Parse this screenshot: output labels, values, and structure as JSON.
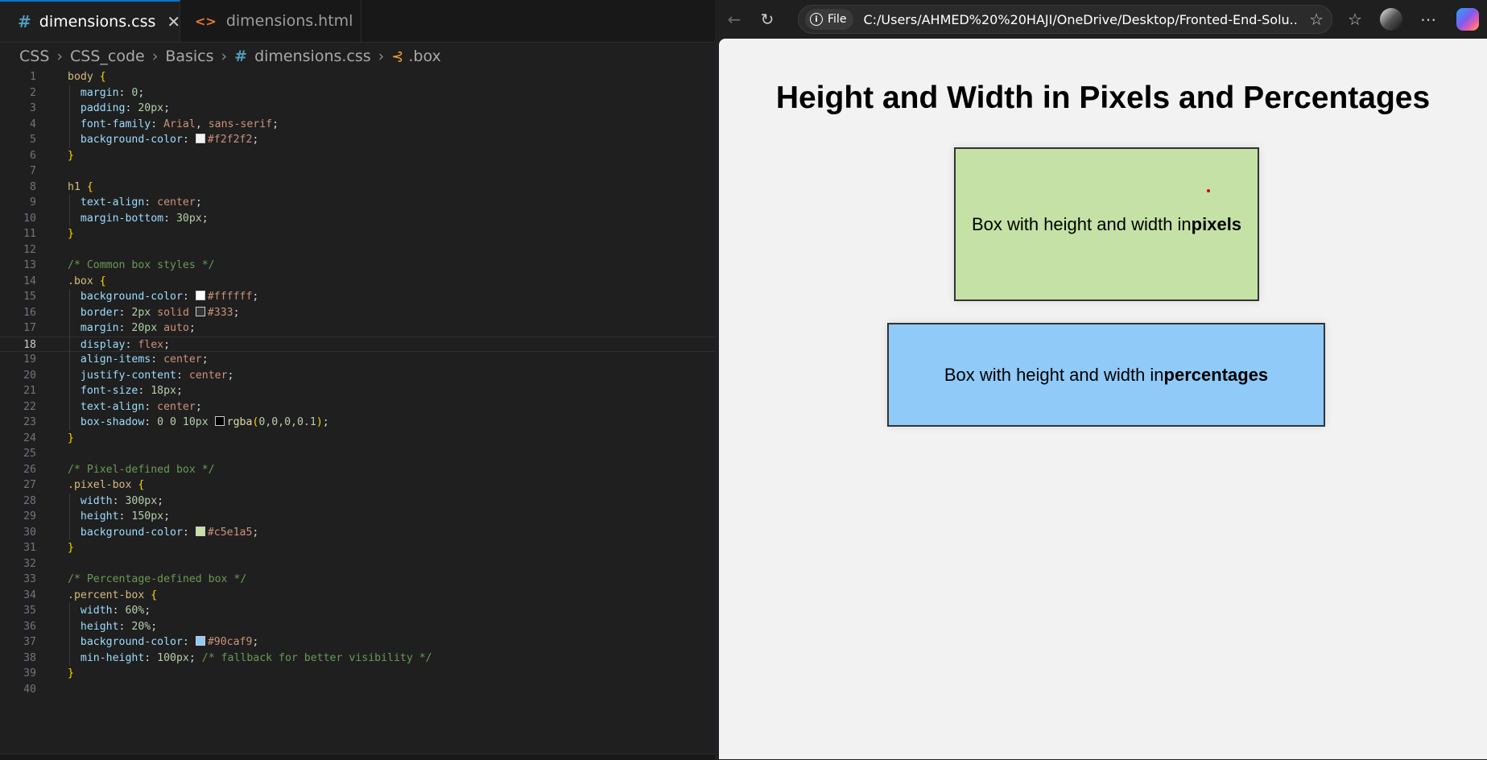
{
  "editor": {
    "tabs": [
      {
        "label": "dimensions.css",
        "active": true,
        "icon": "css-hash-icon"
      },
      {
        "label": "dimensions.html",
        "active": false,
        "icon": "html-code-icon"
      }
    ],
    "breadcrumb": [
      "CSS",
      "CSS_code",
      "Basics",
      "dimensions.css",
      ".box"
    ],
    "current_line": 18,
    "line_numbers": [
      "1",
      "2",
      "3",
      "4",
      "5",
      "6",
      "7",
      "8",
      "9",
      "10",
      "11",
      "12",
      "13",
      "14",
      "15",
      "16",
      "17",
      "18",
      "19",
      "20",
      "21",
      "22",
      "23",
      "24",
      "25",
      "26",
      "27",
      "28",
      "29",
      "30",
      "31",
      "32",
      "33",
      "34",
      "35",
      "36",
      "37",
      "38",
      "39",
      "40"
    ],
    "code_lines": [
      [
        [
          "t-sel",
          "body "
        ],
        [
          "t-br",
          "{"
        ]
      ],
      [
        [
          "t-prop",
          "  margin"
        ],
        [
          "t-pun",
          ": "
        ],
        [
          "t-num",
          "0"
        ],
        [
          "t-pun",
          ";"
        ]
      ],
      [
        [
          "t-prop",
          "  padding"
        ],
        [
          "t-pun",
          ": "
        ],
        [
          "t-num",
          "20px"
        ],
        [
          "t-pun",
          ";"
        ]
      ],
      [
        [
          "t-prop",
          "  font-family"
        ],
        [
          "t-pun",
          ": "
        ],
        [
          "t-val",
          "Arial"
        ],
        [
          "t-pun",
          ", "
        ],
        [
          "t-val",
          "sans-serif"
        ],
        [
          "t-pun",
          ";"
        ]
      ],
      [
        [
          "t-prop",
          "  background-color"
        ],
        [
          "t-pun",
          ": "
        ],
        [
          "sw",
          "#f2f2f2"
        ],
        [
          "t-val",
          "#f2f2f2"
        ],
        [
          "t-pun",
          ";"
        ]
      ],
      [
        [
          "t-br",
          "}"
        ]
      ],
      [],
      [
        [
          "t-sel",
          "h1 "
        ],
        [
          "t-br",
          "{"
        ]
      ],
      [
        [
          "t-prop",
          "  text-align"
        ],
        [
          "t-pun",
          ": "
        ],
        [
          "t-val",
          "center"
        ],
        [
          "t-pun",
          ";"
        ]
      ],
      [
        [
          "t-prop",
          "  margin-bottom"
        ],
        [
          "t-pun",
          ": "
        ],
        [
          "t-num",
          "30px"
        ],
        [
          "t-pun",
          ";"
        ]
      ],
      [
        [
          "t-br",
          "}"
        ]
      ],
      [],
      [
        [
          "t-com",
          "/* Common box styles */"
        ]
      ],
      [
        [
          "t-sel",
          ".box "
        ],
        [
          "t-br",
          "{"
        ]
      ],
      [
        [
          "t-prop",
          "  background-color"
        ],
        [
          "t-pun",
          ": "
        ],
        [
          "sw",
          "#ffffff"
        ],
        [
          "t-val",
          "#ffffff"
        ],
        [
          "t-pun",
          ";"
        ]
      ],
      [
        [
          "t-prop",
          "  border"
        ],
        [
          "t-pun",
          ": "
        ],
        [
          "t-num",
          "2px"
        ],
        [
          "t-val",
          " solid "
        ],
        [
          "sw",
          "#333333"
        ],
        [
          "t-val",
          "#333"
        ],
        [
          "t-pun",
          ";"
        ]
      ],
      [
        [
          "t-prop",
          "  margin"
        ],
        [
          "t-pun",
          ": "
        ],
        [
          "t-num",
          "20px"
        ],
        [
          "t-val",
          " auto"
        ],
        [
          "t-pun",
          ";"
        ]
      ],
      [
        [
          "t-prop",
          "  display"
        ],
        [
          "t-pun",
          ": "
        ],
        [
          "t-val",
          "flex"
        ],
        [
          "t-pun",
          ";"
        ]
      ],
      [
        [
          "t-prop",
          "  align-items"
        ],
        [
          "t-pun",
          ": "
        ],
        [
          "t-val",
          "center"
        ],
        [
          "t-pun",
          ";"
        ]
      ],
      [
        [
          "t-prop",
          "  justify-content"
        ],
        [
          "t-pun",
          ": "
        ],
        [
          "t-val",
          "center"
        ],
        [
          "t-pun",
          ";"
        ]
      ],
      [
        [
          "t-prop",
          "  font-size"
        ],
        [
          "t-pun",
          ": "
        ],
        [
          "t-num",
          "18px"
        ],
        [
          "t-pun",
          ";"
        ]
      ],
      [
        [
          "t-prop",
          "  text-align"
        ],
        [
          "t-pun",
          ": "
        ],
        [
          "t-val",
          "center"
        ],
        [
          "t-pun",
          ";"
        ]
      ],
      [
        [
          "t-prop",
          "  box-shadow"
        ],
        [
          "t-pun",
          ": "
        ],
        [
          "t-num",
          "0 0 10px "
        ],
        [
          "sw",
          "#000000"
        ],
        [
          "t-fn",
          "rgba"
        ],
        [
          "t-br",
          "("
        ],
        [
          "t-num",
          "0,0,0,0.1"
        ],
        [
          "t-br",
          ")"
        ],
        [
          "t-pun",
          ";"
        ]
      ],
      [
        [
          "t-br",
          "}"
        ]
      ],
      [],
      [
        [
          "t-com",
          "/* Pixel-defined box */"
        ]
      ],
      [
        [
          "t-sel",
          ".pixel-box "
        ],
        [
          "t-br",
          "{"
        ]
      ],
      [
        [
          "t-prop",
          "  width"
        ],
        [
          "t-pun",
          ": "
        ],
        [
          "t-num",
          "300px"
        ],
        [
          "t-pun",
          ";"
        ]
      ],
      [
        [
          "t-prop",
          "  height"
        ],
        [
          "t-pun",
          ": "
        ],
        [
          "t-num",
          "150px"
        ],
        [
          "t-pun",
          ";"
        ]
      ],
      [
        [
          "t-prop",
          "  background-color"
        ],
        [
          "t-pun",
          ": "
        ],
        [
          "sw",
          "#c5e1a5"
        ],
        [
          "t-val",
          "#c5e1a5"
        ],
        [
          "t-pun",
          ";"
        ]
      ],
      [
        [
          "t-br",
          "}"
        ]
      ],
      [],
      [
        [
          "t-com",
          "/* Percentage-defined box */"
        ]
      ],
      [
        [
          "t-sel",
          ".percent-box "
        ],
        [
          "t-br",
          "{"
        ]
      ],
      [
        [
          "t-prop",
          "  width"
        ],
        [
          "t-pun",
          ": "
        ],
        [
          "t-num",
          "60%"
        ],
        [
          "t-pun",
          ";"
        ]
      ],
      [
        [
          "t-prop",
          "  height"
        ],
        [
          "t-pun",
          ": "
        ],
        [
          "t-num",
          "20%"
        ],
        [
          "t-pun",
          ";"
        ]
      ],
      [
        [
          "t-prop",
          "  background-color"
        ],
        [
          "t-pun",
          ": "
        ],
        [
          "sw",
          "#90caf9"
        ],
        [
          "t-val",
          "#90caf9"
        ],
        [
          "t-pun",
          ";"
        ]
      ],
      [
        [
          "t-prop",
          "  min-height"
        ],
        [
          "t-pun",
          ": "
        ],
        [
          "t-num",
          "100px"
        ],
        [
          "t-pun",
          "; "
        ],
        [
          "t-com",
          "/* fallback for better visibility */"
        ]
      ],
      [
        [
          "t-br",
          "}"
        ]
      ],
      []
    ]
  },
  "browser": {
    "address_chip": "File",
    "url": "C:/Users/AHMED%20%20HAJI/OneDrive/Desktop/Fronted-End-Solu...",
    "icons": [
      "back-icon",
      "refresh-icon",
      "info-icon",
      "favorite-star-icon",
      "favorites-icon",
      "profile-avatar",
      "more-icon",
      "copilot-icon"
    ],
    "page": {
      "title": "Height and Width in Pixels and Percentages",
      "pixel_box": {
        "text": "Box with height and width in",
        "bold": "pixels",
        "background": "#c5e1a5"
      },
      "percent_box": {
        "text": "Box with height and width in",
        "bold": "percentages",
        "background": "#90caf9"
      }
    }
  }
}
